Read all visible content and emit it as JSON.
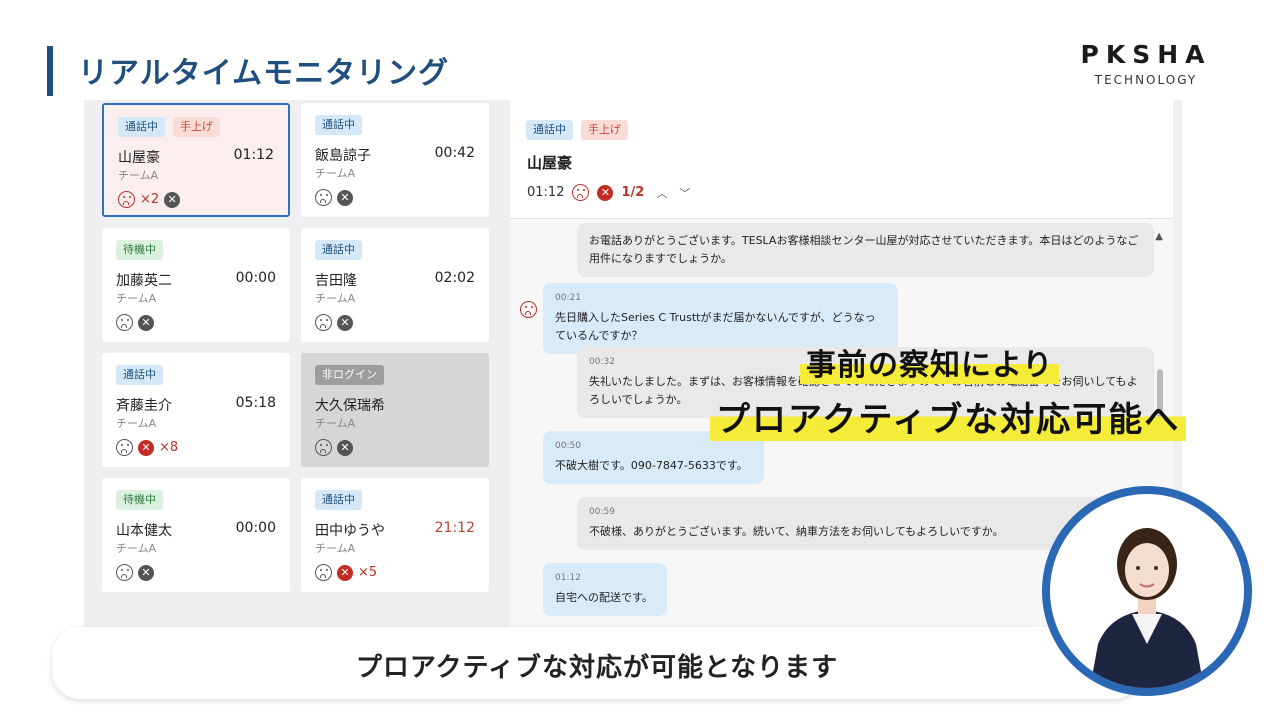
{
  "page": {
    "title": "リアルタイムモニタリング"
  },
  "logo": {
    "main": "PKSHA",
    "sub": "TECHNOLOGY"
  },
  "agents": [
    {
      "status": "通話中",
      "flag": "手上げ",
      "name": "山屋豪",
      "time": "01:12",
      "team": "チームA",
      "alert": "×2"
    },
    {
      "status": "通話中",
      "name": "飯島諒子",
      "time": "00:42",
      "team": "チームA"
    },
    {
      "status": "待機中",
      "name": "加藤英二",
      "time": "00:00",
      "team": "チームA"
    },
    {
      "status": "通話中",
      "name": "吉田隆",
      "time": "02:02",
      "team": "チームA"
    },
    {
      "status": "通話中",
      "name": "斉藤圭介",
      "time": "05:18",
      "team": "チームA",
      "alert": "×8"
    },
    {
      "status": "非ログイン",
      "name": "大久保瑞希",
      "time": "",
      "team": "チームA"
    },
    {
      "status": "待機中",
      "name": "山本健太",
      "time": "00:00",
      "team": "チームA"
    },
    {
      "status": "通話中",
      "name": "田中ゆうや",
      "time": "21:12",
      "team": "チームA",
      "alert": "×5"
    }
  ],
  "detail": {
    "status": "通話中",
    "flag": "手上げ",
    "name": "山屋豪",
    "time": "01:12",
    "alert_index": "1/2",
    "nav_up": "^",
    "nav_down": "v"
  },
  "transcript": [
    {
      "speaker": "operator",
      "time": "",
      "text": "お電話ありがとうございます。TESLAお客様相談センター山屋が対応させていただきます。本日はどのようなご用件になりますでしょうか。"
    },
    {
      "speaker": "customer",
      "time": "00:21",
      "text": "先日購入したSeries C Trusttがまだ届かないんですが、どうなっているんですか？"
    },
    {
      "speaker": "operator",
      "time": "00:32",
      "text": "失礼いたしました。まずは、お客様情報を確認させていただきますので、お名前とお電話番号をお伺いしてもよろしいでしょうか。"
    },
    {
      "speaker": "customer",
      "time": "00:50",
      "text": "不破大樹です。090-7847-5633です。"
    },
    {
      "speaker": "operator",
      "time": "00:59",
      "text": "不破様、ありがとうございます。続いて、納車方法をお伺いしてもよろしいですか。"
    },
    {
      "speaker": "customer",
      "time": "01:12",
      "text": "自宅への配送です。"
    }
  ],
  "overlay": {
    "line1": "事前の察知により",
    "line2": "プロアクティブな対応可能へ"
  },
  "caption": "プロアクティブな対応が可能となります",
  "colors": {
    "accent": "#1f4f7e",
    "alert": "#c22c22",
    "highlight": "#f5ec3a",
    "selected_border": "#2e6fc0"
  }
}
